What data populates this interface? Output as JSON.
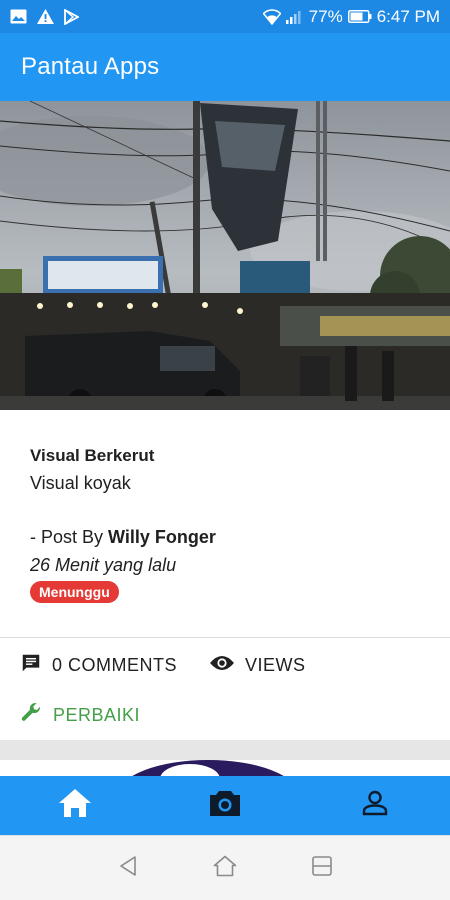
{
  "status_bar": {
    "battery": "77%",
    "time": "6:47 PM",
    "icons": [
      "image-icon",
      "warning-icon",
      "play-store-icon",
      "wifi-icon",
      "signal-icon",
      "battery-icon"
    ]
  },
  "app_bar": {
    "title": "Pantau Apps"
  },
  "post": {
    "title": "Visual Berkerut",
    "description": "Visual koyak",
    "by_prefix": "- Post By ",
    "author": "Willy Fonger",
    "time": "26 Menit yang lalu",
    "status": "Menunggu"
  },
  "actions": {
    "comments": "0 COMMENTS",
    "views": "VIEWS",
    "fix": "PERBAIKI"
  },
  "bottom_nav": {
    "items": [
      "home-icon",
      "camera-icon",
      "person-icon"
    ]
  },
  "system_nav": {
    "items": [
      "back-icon",
      "home-outline-icon",
      "recents-icon"
    ]
  },
  "colors": {
    "primary": "#2196f3",
    "status_bar": "#1e88e5",
    "badge": "#e53935",
    "fix": "#43a047"
  }
}
